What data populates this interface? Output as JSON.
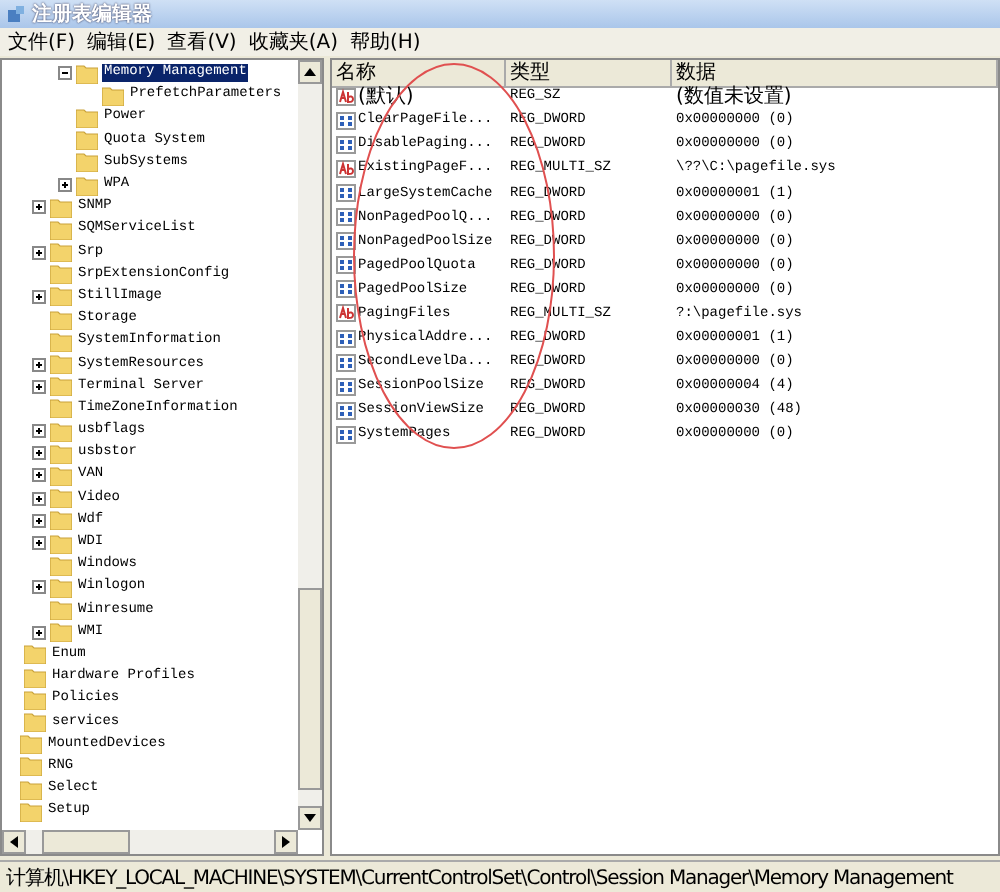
{
  "window": {
    "title": "注册表编辑器"
  },
  "menu": [
    "文件(F)",
    "编辑(E)",
    "查看(V)",
    "收藏夹(A)",
    "帮助(H)"
  ],
  "tree": [
    {
      "children": [
        {
          "children": [
            {
              "children": [
                {
                  "label": "Memory Management",
                  "selected": true,
                  "expanded": true,
                  "children": [
                    {
                      "label": "PrefetchParameters",
                      "selected": false
                    }
                  ]
                },
                {
                  "label": "Power",
                  "selected": false
                },
                {
                  "label": "Quota System",
                  "selected": false
                },
                {
                  "label": "SubSystems",
                  "selected": false
                },
                {
                  "label": "WPA",
                  "selected": false,
                  "expanded": false
                }
              ]
            },
            {
              "label": "SNMP",
              "selected": false,
              "expanded": false
            },
            {
              "label": "SQMServiceList",
              "selected": false
            },
            {
              "label": "Srp",
              "selected": false,
              "expanded": false
            },
            {
              "label": "SrpExtensionConfig",
              "selected": false
            },
            {
              "label": "StillImage",
              "selected": false,
              "expanded": false
            },
            {
              "label": "Storage",
              "selected": false
            },
            {
              "label": "SystemInformation",
              "selected": false
            },
            {
              "label": "SystemResources",
              "selected": false,
              "expanded": false
            },
            {
              "label": "Terminal Server",
              "selected": false,
              "expanded": false
            },
            {
              "label": "TimeZoneInformation",
              "selected": false
            },
            {
              "label": "usbflags",
              "selected": false,
              "expanded": false
            },
            {
              "label": "usbstor",
              "selected": false,
              "expanded": false
            },
            {
              "label": "VAN",
              "selected": false,
              "expanded": false
            },
            {
              "label": "Video",
              "selected": false,
              "expanded": false
            },
            {
              "label": "Wdf",
              "selected": false,
              "expanded": false
            },
            {
              "label": "WDI",
              "selected": false,
              "expanded": false
            },
            {
              "label": "Windows",
              "selected": false
            },
            {
              "label": "Winlogon",
              "selected": false,
              "expanded": false
            },
            {
              "label": "Winresume",
              "selected": false
            },
            {
              "label": "WMI",
              "selected": false,
              "expanded": false
            }
          ]
        },
        {
          "label": "Enum",
          "selected": false
        },
        {
          "label": "Hardware Profiles",
          "selected": false
        },
        {
          "label": "Policies",
          "selected": false
        },
        {
          "label": "services",
          "selected": false
        }
      ]
    },
    {
      "label": "MountedDevices",
      "selected": false
    },
    {
      "label": "RNG",
      "selected": false
    },
    {
      "label": "Select",
      "selected": false
    },
    {
      "label": "Setup",
      "selected": false
    }
  ],
  "table": {
    "columns": [
      "名称",
      "类型",
      "数据"
    ],
    "rows": [
      {
        "kind": "string",
        "name": "(默认)",
        "type": "REG_SZ",
        "data": "(数值未设置)"
      },
      {
        "kind": "binary",
        "name": "ClearPageFile...",
        "type": "REG_DWORD",
        "data": "0x00000000 (0)"
      },
      {
        "kind": "binary",
        "name": "DisablePaging...",
        "type": "REG_DWORD",
        "data": "0x00000000 (0)"
      },
      {
        "kind": "string",
        "name": "ExistingPageF...",
        "type": "REG_MULTI_SZ",
        "data": "\\??\\C:\\pagefile.sys"
      },
      {
        "kind": "binary",
        "name": "LargeSystemCache",
        "type": "REG_DWORD",
        "data": "0x00000001 (1)"
      },
      {
        "kind": "binary",
        "name": "NonPagedPoolQ...",
        "type": "REG_DWORD",
        "data": "0x00000000 (0)"
      },
      {
        "kind": "binary",
        "name": "NonPagedPoolSize",
        "type": "REG_DWORD",
        "data": "0x00000000 (0)"
      },
      {
        "kind": "binary",
        "name": "PagedPoolQuota",
        "type": "REG_DWORD",
        "data": "0x00000000 (0)"
      },
      {
        "kind": "binary",
        "name": "PagedPoolSize",
        "type": "REG_DWORD",
        "data": "0x00000000 (0)"
      },
      {
        "kind": "string",
        "name": "PagingFiles",
        "type": "REG_MULTI_SZ",
        "data": "?:\\pagefile.sys"
      },
      {
        "kind": "binary",
        "name": "PhysicalAddre...",
        "type": "REG_DWORD",
        "data": "0x00000001 (1)"
      },
      {
        "kind": "binary",
        "name": "SecondLevelDa...",
        "type": "REG_DWORD",
        "data": "0x00000000 (0)"
      },
      {
        "kind": "binary",
        "name": "SessionPoolSize",
        "type": "REG_DWORD",
        "data": "0x00000004 (4)"
      },
      {
        "kind": "binary",
        "name": "SessionViewSize",
        "type": "REG_DWORD",
        "data": "0x00000030 (48)"
      },
      {
        "kind": "binary",
        "name": "SystemPages",
        "type": "REG_DWORD",
        "data": "0x00000000 (0)"
      }
    ]
  },
  "status_bar": "计算机\\HKEY_LOCAL_MACHINE\\SYSTEM\\CurrentControlSet\\Control\\Session Manager\\Memory Management"
}
